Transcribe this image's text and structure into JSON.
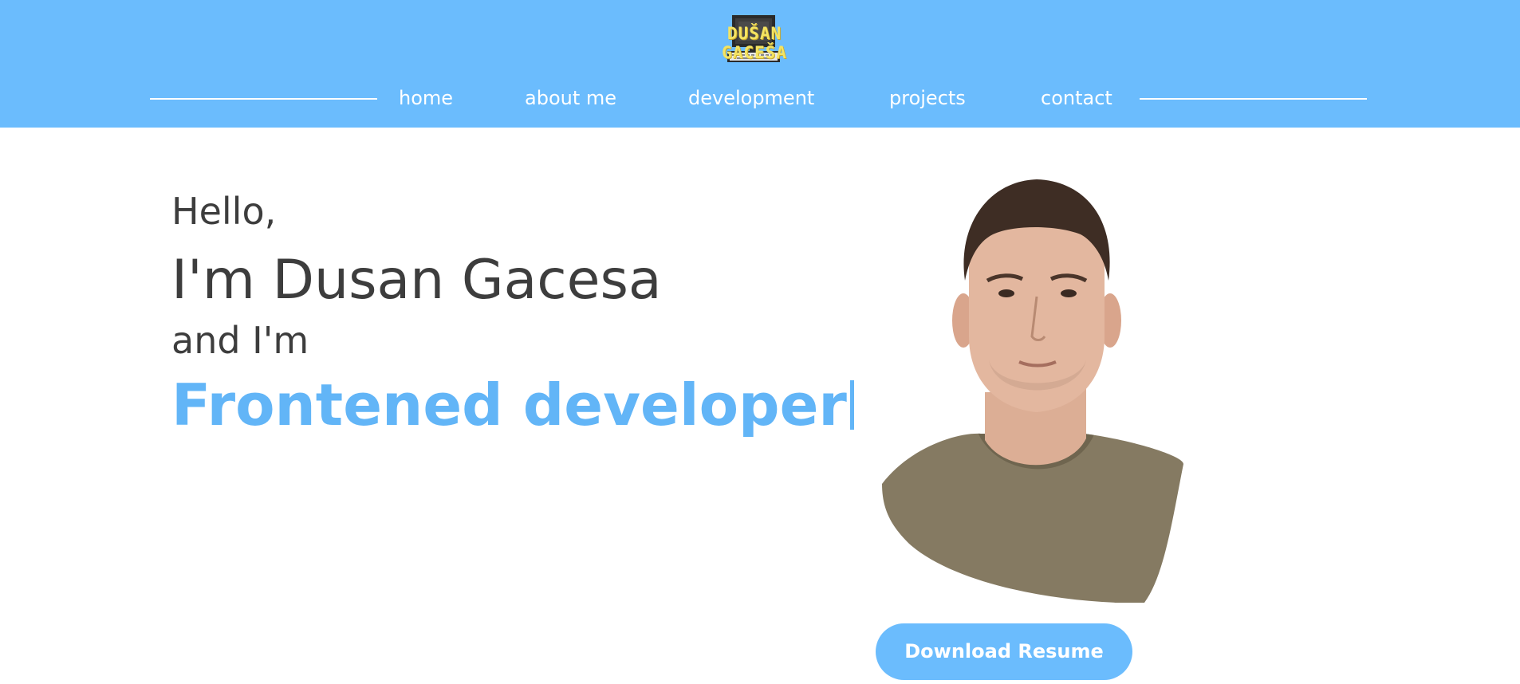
{
  "header": {
    "logo_text": "DUŠAN GACEŠA",
    "nav": [
      {
        "label": "home"
      },
      {
        "label": "about me"
      },
      {
        "label": "development"
      },
      {
        "label": "projects"
      },
      {
        "label": "contact"
      }
    ]
  },
  "hero": {
    "hello": "Hello,",
    "name": "I'm Dusan Gacesa",
    "and": "and I'm",
    "role": "Frontened developer"
  },
  "actions": {
    "download_label": "Download Resume"
  },
  "colors": {
    "header_bg": "#6bbcfd",
    "accent": "#62b5f7",
    "logo_yellow": "#f4e462",
    "text_dark": "#3d3d3d"
  }
}
